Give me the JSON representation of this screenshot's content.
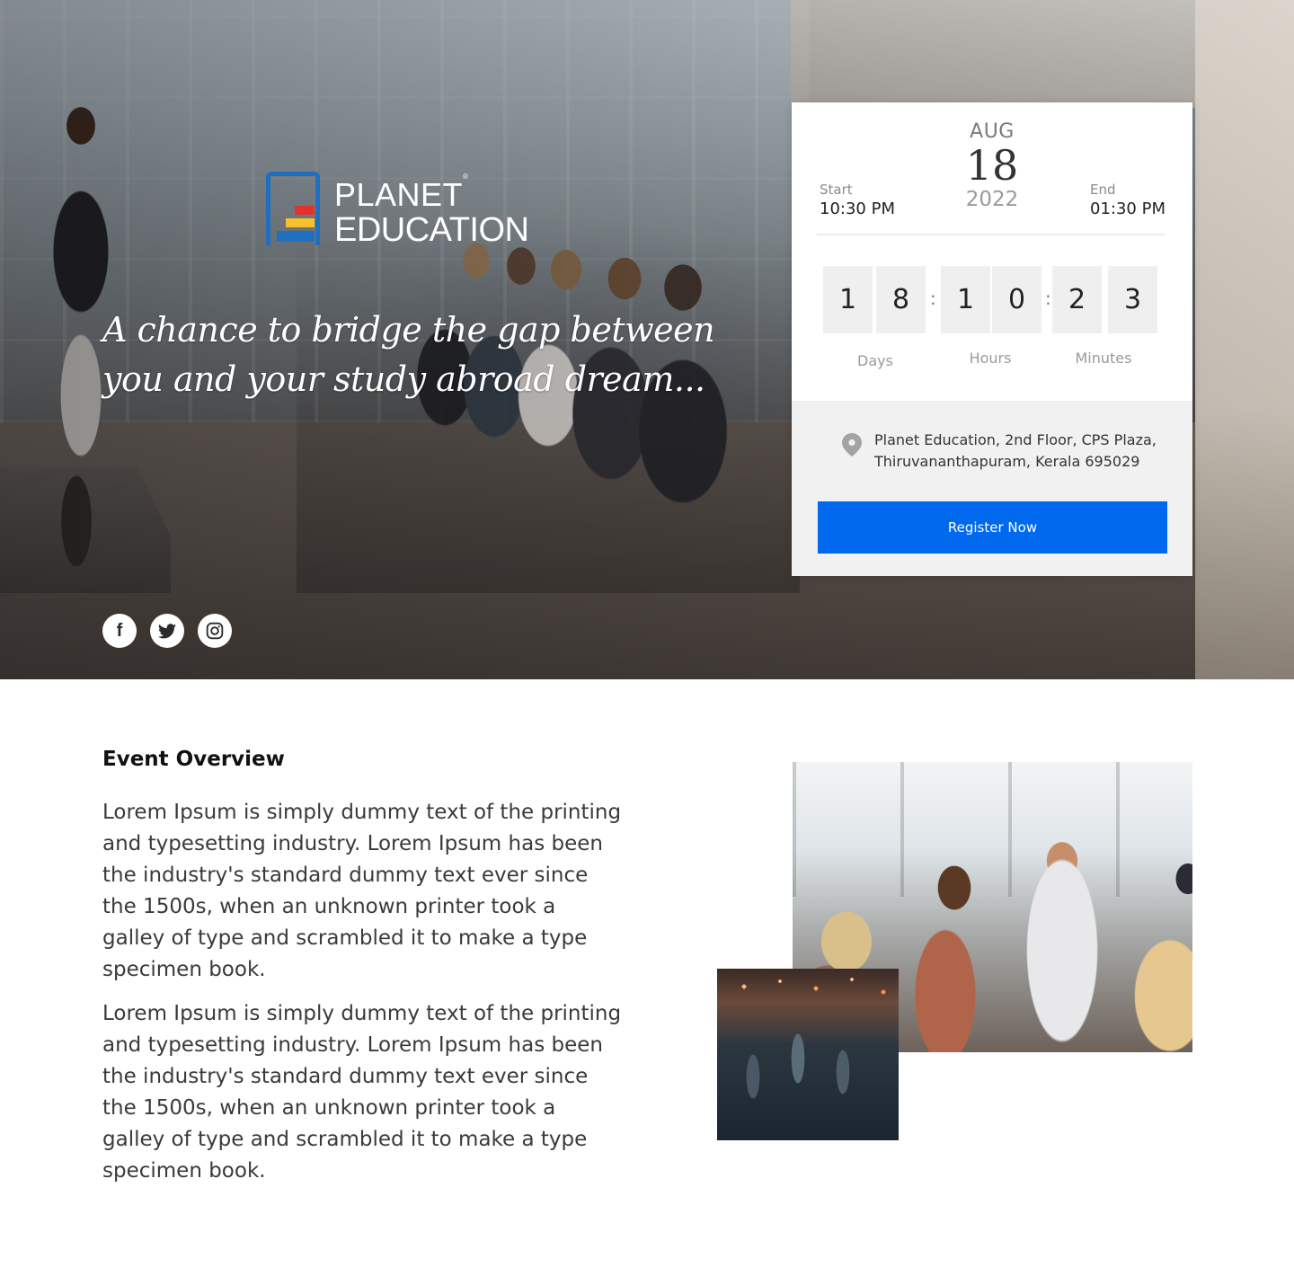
{
  "brand": {
    "line1": "PLANET",
    "registered": "®",
    "line2": "EDUCATION",
    "colors": {
      "blue": "#1f6fc0",
      "red": "#e2322b",
      "yellow": "#f6c12b"
    }
  },
  "hero": {
    "tagline": "A chance to bridge the gap between you and your study abroad dream...",
    "background_image": "classroom-seminar-photo",
    "socials": [
      {
        "name": "facebook",
        "glyph": "f"
      },
      {
        "name": "twitter",
        "glyph": "🐦"
      },
      {
        "name": "instagram",
        "glyph": "◎"
      }
    ]
  },
  "event": {
    "start_label": "Start",
    "start_time": "10:30 PM",
    "month": "AUG",
    "day": "18",
    "year": "2022",
    "end_label": "End",
    "end_time": "01:30 PM",
    "countdown": {
      "days": [
        "1",
        "8"
      ],
      "hours": [
        "1",
        "0"
      ],
      "minutes": [
        "2",
        "3"
      ],
      "separator": ":",
      "labels": {
        "days": "Days",
        "hours": "Hours",
        "minutes": "Minutes"
      }
    },
    "address_line1": "Planet Education, 2nd Floor, CPS Plaza,",
    "address_line2": "Thiruvananthapuram, Kerala 695029",
    "register_label": "Register Now",
    "accent_color": "#0069ee"
  },
  "overview": {
    "title": "Event Overview",
    "paragraphs": [
      "Lorem Ipsum is simply dummy text of the printing and typesetting industry. Lorem Ipsum has been the industry's standard dummy text ever since the 1500s, when an unknown printer took a galley of type and scrambled it to make a type specimen book.",
      "Lorem Ipsum is simply dummy text of the printing and typesetting industry. Lorem Ipsum has been the industry's standard dummy text ever since the 1500s, when an unknown printer took a galley of type and scrambled it to make a type specimen book."
    ]
  }
}
